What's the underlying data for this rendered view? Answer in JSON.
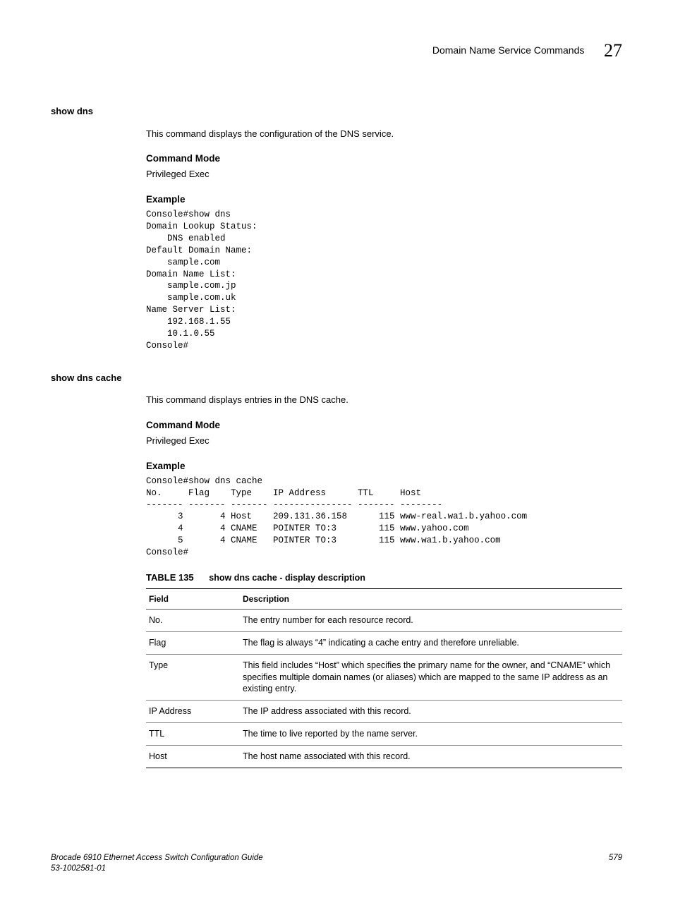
{
  "header": {
    "title": "Domain Name Service Commands",
    "chapter": "27"
  },
  "sections": [
    {
      "cmd": "show dns",
      "desc": "This command displays the configuration of the DNS service.",
      "mode_head": "Command Mode",
      "mode_val": "Privileged Exec",
      "example_head": "Example",
      "code": "Console#show dns\nDomain Lookup Status:\n    DNS enabled\nDefault Domain Name:\n    sample.com\nDomain Name List:\n    sample.com.jp\n    sample.com.uk\nName Server List:\n    192.168.1.55\n    10.1.0.55\nConsole#"
    },
    {
      "cmd": "show dns cache",
      "desc": "This command displays entries in the DNS cache.",
      "mode_head": "Command Mode",
      "mode_val": "Privileged Exec",
      "example_head": "Example",
      "code": "Console#show dns cache\nNo.     Flag    Type    IP Address      TTL     Host\n------- ------- ------- --------------- ------- --------\n      3       4 Host    209.131.36.158      115 www-real.wa1.b.yahoo.com\n      4       4 CNAME   POINTER TO:3        115 www.yahoo.com\n      5       4 CNAME   POINTER TO:3        115 www.wa1.b.yahoo.com\nConsole#"
    }
  ],
  "table": {
    "num": "TABLE 135",
    "title": "show dns cache - display description",
    "headers": {
      "field": "Field",
      "desc": "Description"
    },
    "rows": [
      {
        "field": "No.",
        "desc": "The entry number for each resource record."
      },
      {
        "field": "Flag",
        "desc": "The flag is always “4” indicating a cache entry and therefore unreliable."
      },
      {
        "field": "Type",
        "desc": "This field includes “Host” which specifies the primary name for the owner, and “CNAME” which specifies multiple domain names (or aliases) which are mapped to the same IP address as an existing entry."
      },
      {
        "field": "IP Address",
        "desc": "The IP address associated with this record."
      },
      {
        "field": "TTL",
        "desc": "The time to live reported by the name server."
      },
      {
        "field": "Host",
        "desc": "The host name associated with this record."
      }
    ]
  },
  "footer": {
    "line1": "Brocade 6910 Ethernet Access Switch Configuration Guide",
    "line2": "53-1002581-01",
    "page": "579"
  }
}
